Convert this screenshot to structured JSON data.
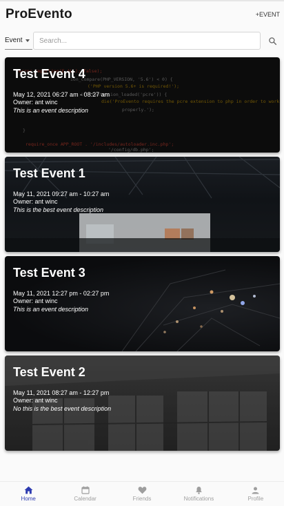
{
  "header": {
    "title": "ProEvento",
    "add_event_label": "+EVENT"
  },
  "search": {
    "filter_value": "Event",
    "placeholder": "Search..."
  },
  "events": [
    {
      "title": "Test Event 4",
      "date": "May 12, 2021 06:27 am - 08:27 am",
      "owner": "Owner: ant winc",
      "description": "This is an event description"
    },
    {
      "title": "Test Event 1",
      "date": "May 11, 2021 09:27 am - 10:27 am",
      "owner": "Owner: ant winc",
      "description": "This is the best event description"
    },
    {
      "title": "Test Event 3",
      "date": "May 11, 2021 12:27 pm - 02:27 pm",
      "owner": "Owner: ant winc",
      "description": "This is an event description"
    },
    {
      "title": "Test Event 2",
      "date": "May 11, 2021 08:27 am - 12:27 pm",
      "owner": "Owner: ant winc",
      "description": "No this is the best event description"
    }
  ],
  "nav": {
    "items": [
      {
        "label": "Home",
        "icon": "home-icon"
      },
      {
        "label": "Calendar",
        "icon": "calendar-icon"
      },
      {
        "label": "Friends",
        "icon": "heart-icon"
      },
      {
        "label": "Notifications",
        "icon": "bell-icon"
      },
      {
        "label": "Profile",
        "icon": "person-icon"
      }
    ],
    "active_color": "#2d3bb0",
    "inactive_color": "#9e9e9e"
  }
}
